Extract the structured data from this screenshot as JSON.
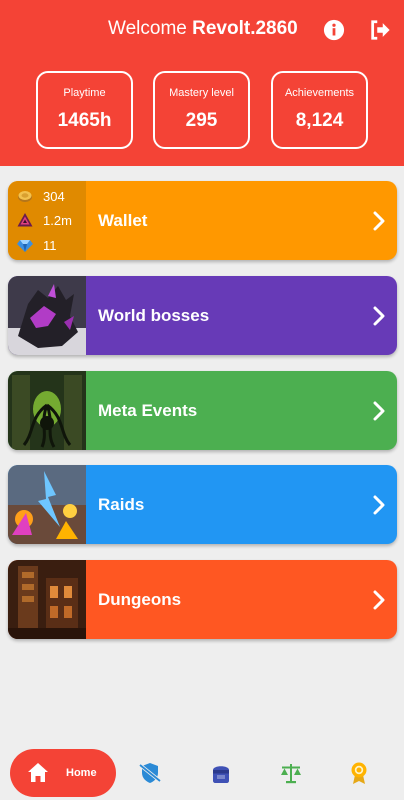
{
  "header": {
    "welcome_prefix": "Welcome",
    "username": "Revolt.2860",
    "info_icon": "info-icon",
    "logout_icon": "logout-icon",
    "bg_color": "#f44336"
  },
  "stats": [
    {
      "label": "Playtime",
      "value": "1465h"
    },
    {
      "label": "Mastery level",
      "value": "295"
    },
    {
      "label": "Achievements",
      "value": "8,124"
    }
  ],
  "wallet": {
    "title": "Wallet",
    "color": "#ff9800",
    "currencies": [
      {
        "icon": "gold-coin-icon",
        "amount": "304"
      },
      {
        "icon": "karma-icon",
        "amount": "1.2m"
      },
      {
        "icon": "gem-icon",
        "amount": "11"
      }
    ]
  },
  "cards": [
    {
      "title": "World bosses",
      "color": "#673ab7"
    },
    {
      "title": "Meta Events",
      "color": "#4caf50"
    },
    {
      "title": "Raids",
      "color": "#2196f3"
    },
    {
      "title": "Dungeons",
      "color": "#ff5722"
    }
  ],
  "nav": {
    "home_label": "Home",
    "active_color": "#f44336",
    "items": [
      "home-icon",
      "shield-icon",
      "bag-icon",
      "scales-icon",
      "medal-icon"
    ]
  }
}
